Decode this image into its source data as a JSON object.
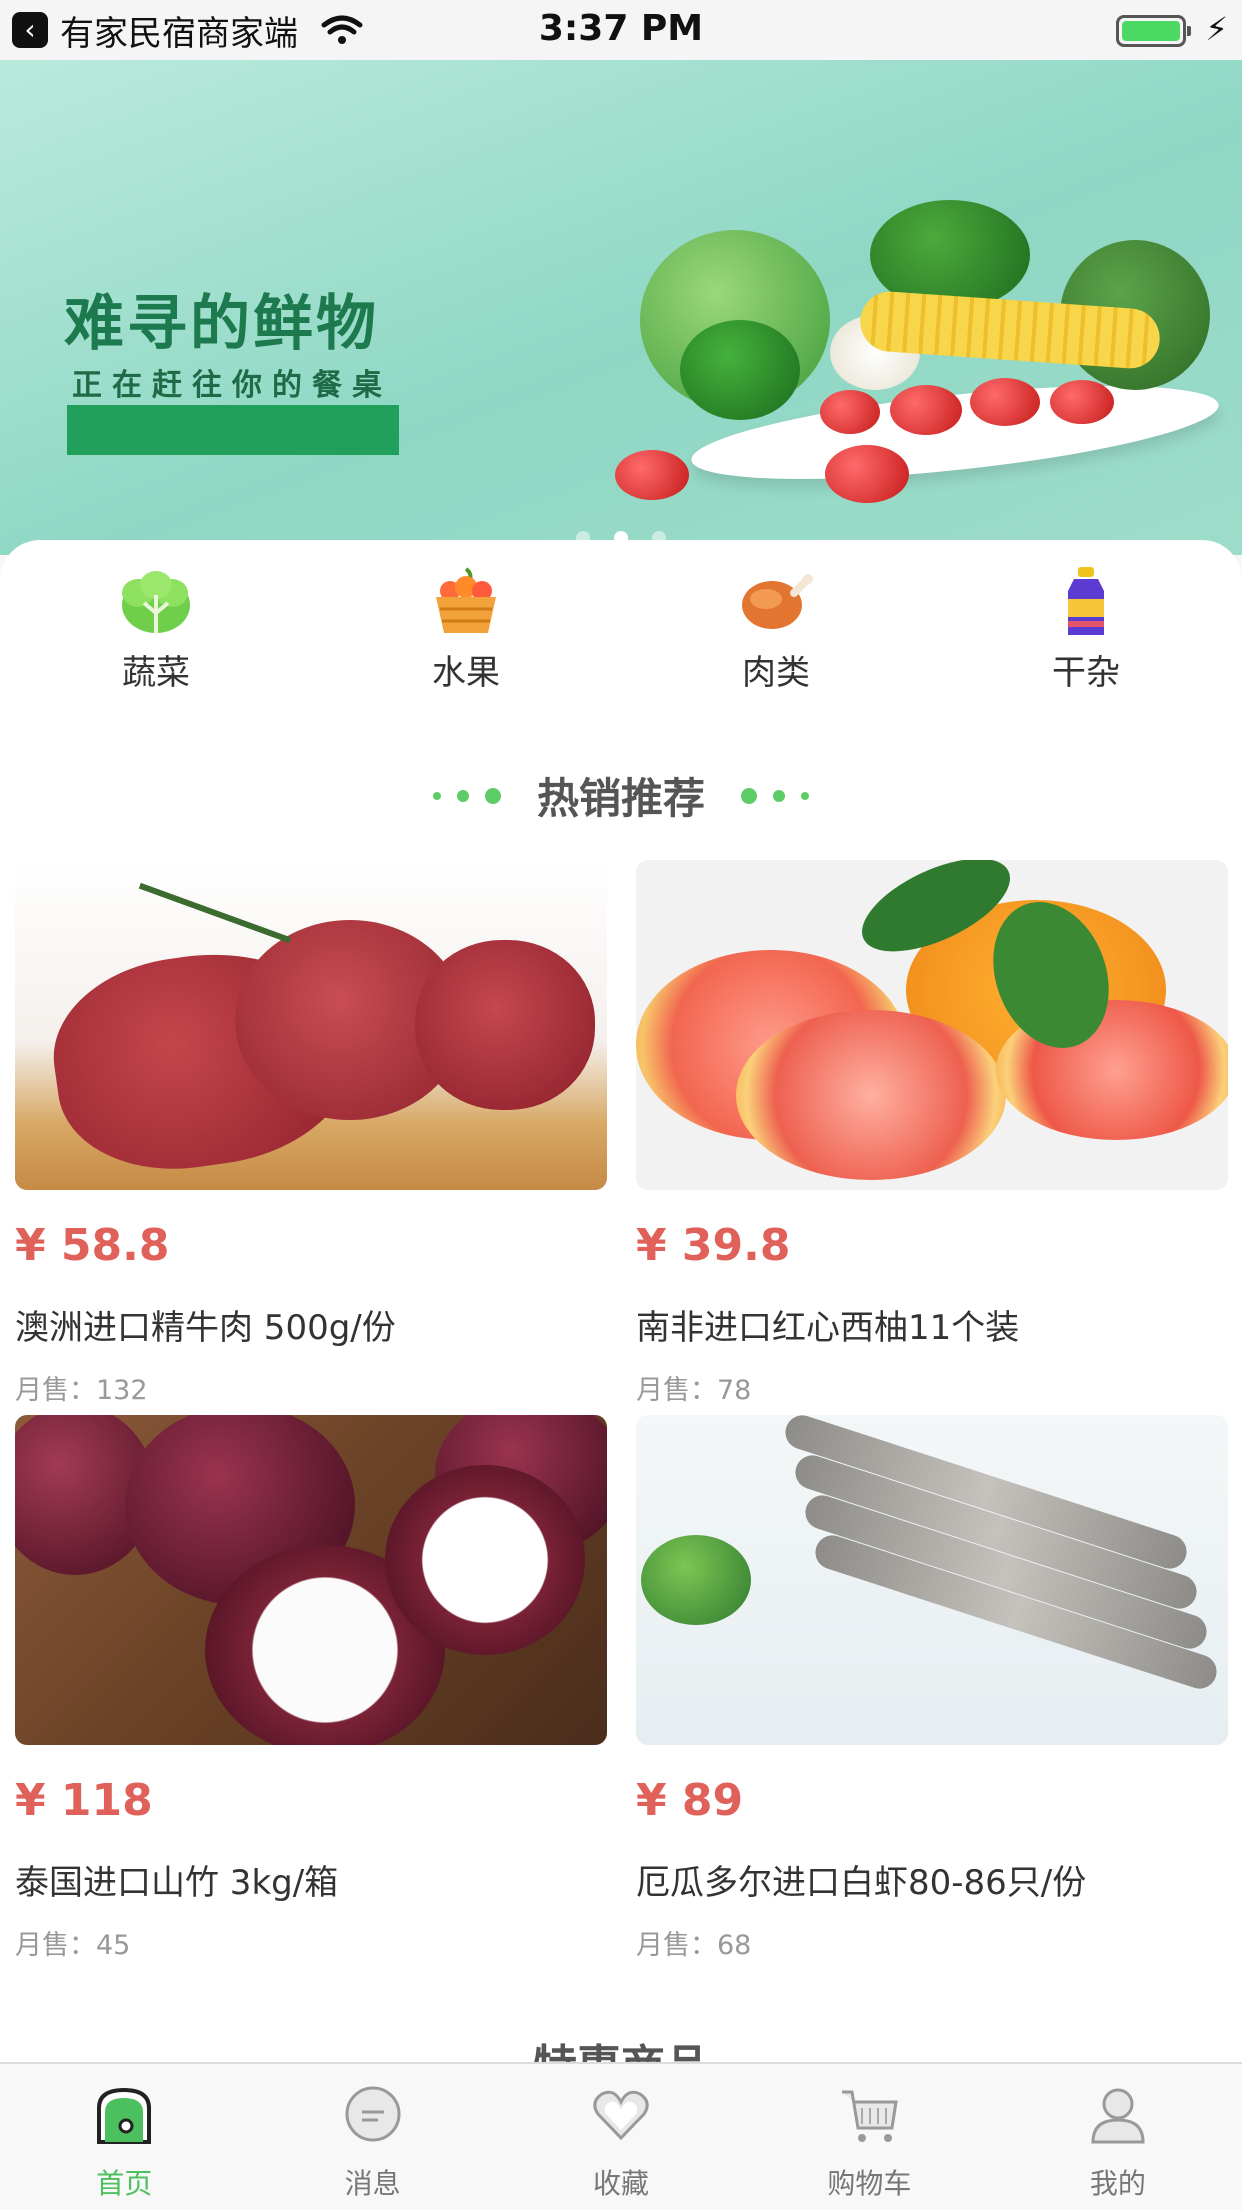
{
  "status_bar": {
    "app_name": "有家民宿商家端",
    "time": "3:37 PM",
    "battery_icon": "battery-charging-icon"
  },
  "banner": {
    "title": "难寻的鲜物",
    "subtitle": "正在赶往你的餐桌",
    "page_count": 3,
    "active_page": 2
  },
  "categories": [
    {
      "label": "蔬菜",
      "icon": "vegetable-icon"
    },
    {
      "label": "水果",
      "icon": "fruit-basket-icon"
    },
    {
      "label": "肉类",
      "icon": "meat-icon"
    },
    {
      "label": "干杂",
      "icon": "dry-goods-icon"
    }
  ],
  "hot_section": {
    "title": "热销推荐",
    "products": [
      {
        "price": "¥ 58.8",
        "name": "澳洲进口精牛肉 500g/份",
        "sales": "月售：132",
        "image": "beef-image"
      },
      {
        "price": "¥ 39.8",
        "name": "南非进口红心西柚11个装",
        "sales": "月售：78",
        "image": "grapefruit-image"
      },
      {
        "price": "¥ 118",
        "name": "泰国进口山竹 3kg/箱",
        "sales": "月售：45",
        "image": "mangosteen-image"
      },
      {
        "price": "¥ 89",
        "name": "厄瓜多尔进口白虾80-86只/份",
        "sales": "月售：68",
        "image": "shrimp-image"
      }
    ]
  },
  "next_section": {
    "title": "特惠商品"
  },
  "tabbar": {
    "items": [
      {
        "label": "首页",
        "icon": "home-icon",
        "active": true
      },
      {
        "label": "消息",
        "icon": "message-icon",
        "active": false
      },
      {
        "label": "收藏",
        "icon": "heart-icon",
        "active": false
      },
      {
        "label": "购物车",
        "icon": "cart-icon",
        "active": false
      },
      {
        "label": "我的",
        "icon": "profile-icon",
        "active": false
      }
    ]
  },
  "colors": {
    "accent": "#4cbf5e",
    "price": "#e0605a",
    "banner_green": "#1d7a4e"
  }
}
